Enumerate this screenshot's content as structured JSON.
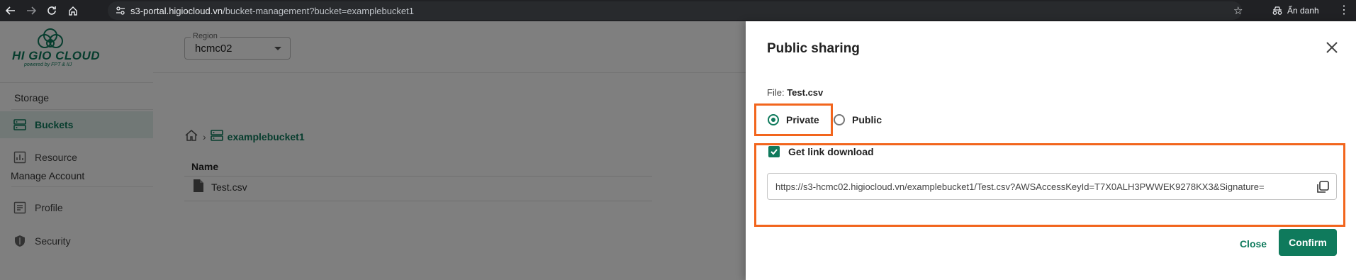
{
  "browser": {
    "url_host": "s3-portal.higiocloud.vn",
    "url_path": "/bucket-management?bucket=examplebucket1",
    "profile_label": "Ẩn danh"
  },
  "logo": {
    "text": "HI GIO CLOUD",
    "tagline": "powered by FPT & IIJ",
    "brand_color": "#0f7a5c"
  },
  "sidebar": {
    "storage_title": "Storage",
    "manage_title": "Manage Account",
    "items": [
      {
        "label": "Buckets",
        "icon": "bucket-icon",
        "active": true
      },
      {
        "label": "Resource",
        "icon": "chart-icon",
        "active": false
      },
      {
        "label": "Profile",
        "icon": "profile-icon",
        "active": false
      },
      {
        "label": "Security",
        "icon": "shield-icon",
        "active": false
      }
    ]
  },
  "main": {
    "region_label": "Region",
    "region_value": "hcmc02",
    "breadcrumb_bucket": "examplebucket1",
    "table_header_name": "Name",
    "files": [
      "Test.csv"
    ]
  },
  "dialog": {
    "title": "Public sharing",
    "file_prefix": "File:",
    "file_name": "Test.csv",
    "private_label": "Private",
    "public_label": "Public",
    "selected": "private",
    "get_link_label": "Get link download",
    "get_link_checked": true,
    "link_url": "https://s3-hcmc02.higiocloud.vn/examplebucket1/Test.csv?AWSAccessKeyId=T7X0ALH3PWWEK9278KX3&Signature=",
    "close_label": "Close",
    "confirm_label": "Confirm",
    "highlight_color": "#f2651d"
  }
}
